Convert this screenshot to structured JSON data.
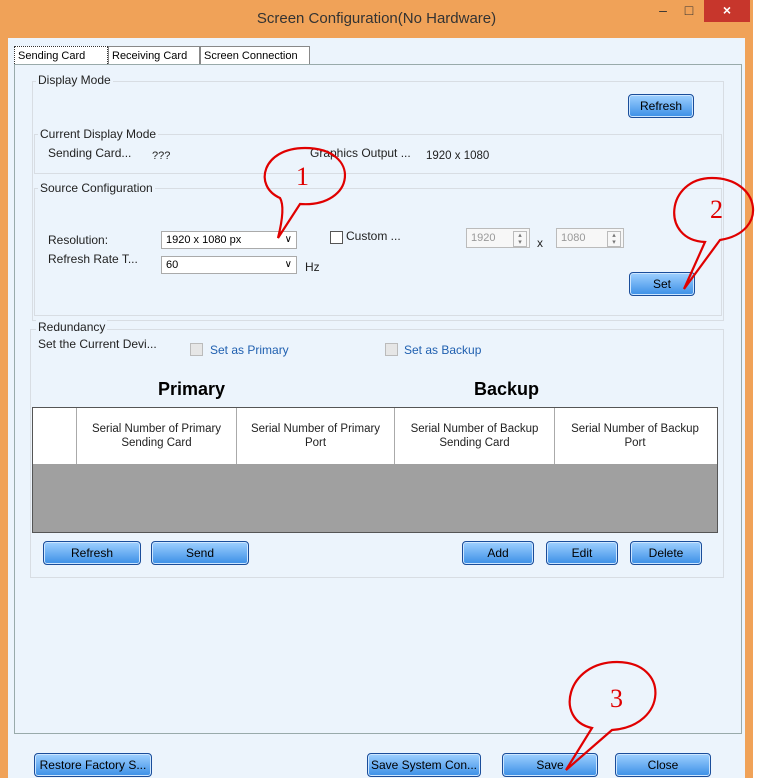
{
  "window": {
    "title": "Screen Configuration(No Hardware)",
    "min_glyph": "–",
    "max_glyph": "□",
    "close_glyph": "×"
  },
  "tabs": [
    {
      "label": "Sending Card",
      "active": true
    },
    {
      "label": "Receiving Card",
      "active": false
    },
    {
      "label": "Screen Connection",
      "active": false
    }
  ],
  "display_mode": {
    "group_title": "Display Mode",
    "refresh_label": "Refresh"
  },
  "current_display": {
    "group_title": "Current Display Mode",
    "sending_card_label": "Sending Card...",
    "sending_card_value": "???",
    "graphics_output_label": "Graphics Output ...",
    "graphics_output_value": "1920 x 1080"
  },
  "source_config": {
    "group_title": "Source Configuration",
    "resolution_label": "Resolution:",
    "resolution_value": "1920 x 1080 px",
    "refresh_rate_label": "Refresh Rate T...",
    "refresh_rate_value": "60",
    "hz_label": "Hz",
    "custom_label": "Custom ...",
    "width_value": "1920",
    "x_label": "x",
    "height_value": "1080",
    "set_label": "Set"
  },
  "redundancy": {
    "group_title": "Redundancy",
    "set_current_label": "Set the Current Devi...",
    "set_primary_label": "Set as Primary",
    "set_backup_label": "Set as Backup",
    "primary_heading": "Primary",
    "backup_heading": "Backup",
    "columns": [
      "Serial Number of Primary Sending Card",
      "Serial Number of Primary Port",
      "Serial Number of Backup Sending Card",
      "Serial Number of Backup Port"
    ],
    "refresh_label": "Refresh",
    "send_label": "Send",
    "add_label": "Add",
    "edit_label": "Edit",
    "delete_label": "Delete"
  },
  "footer": {
    "restore_label": "Restore Factory S...",
    "save_system_label": "Save System Con...",
    "save_label": "Save",
    "close_label": "Close"
  },
  "callouts": [
    "1",
    "2",
    "3"
  ],
  "colors": {
    "frame": "#f0a258",
    "client_bg": "#ecf4fc",
    "button": "#3b8fe6",
    "close_btn": "#c7362c",
    "annotation": "#e00000"
  }
}
